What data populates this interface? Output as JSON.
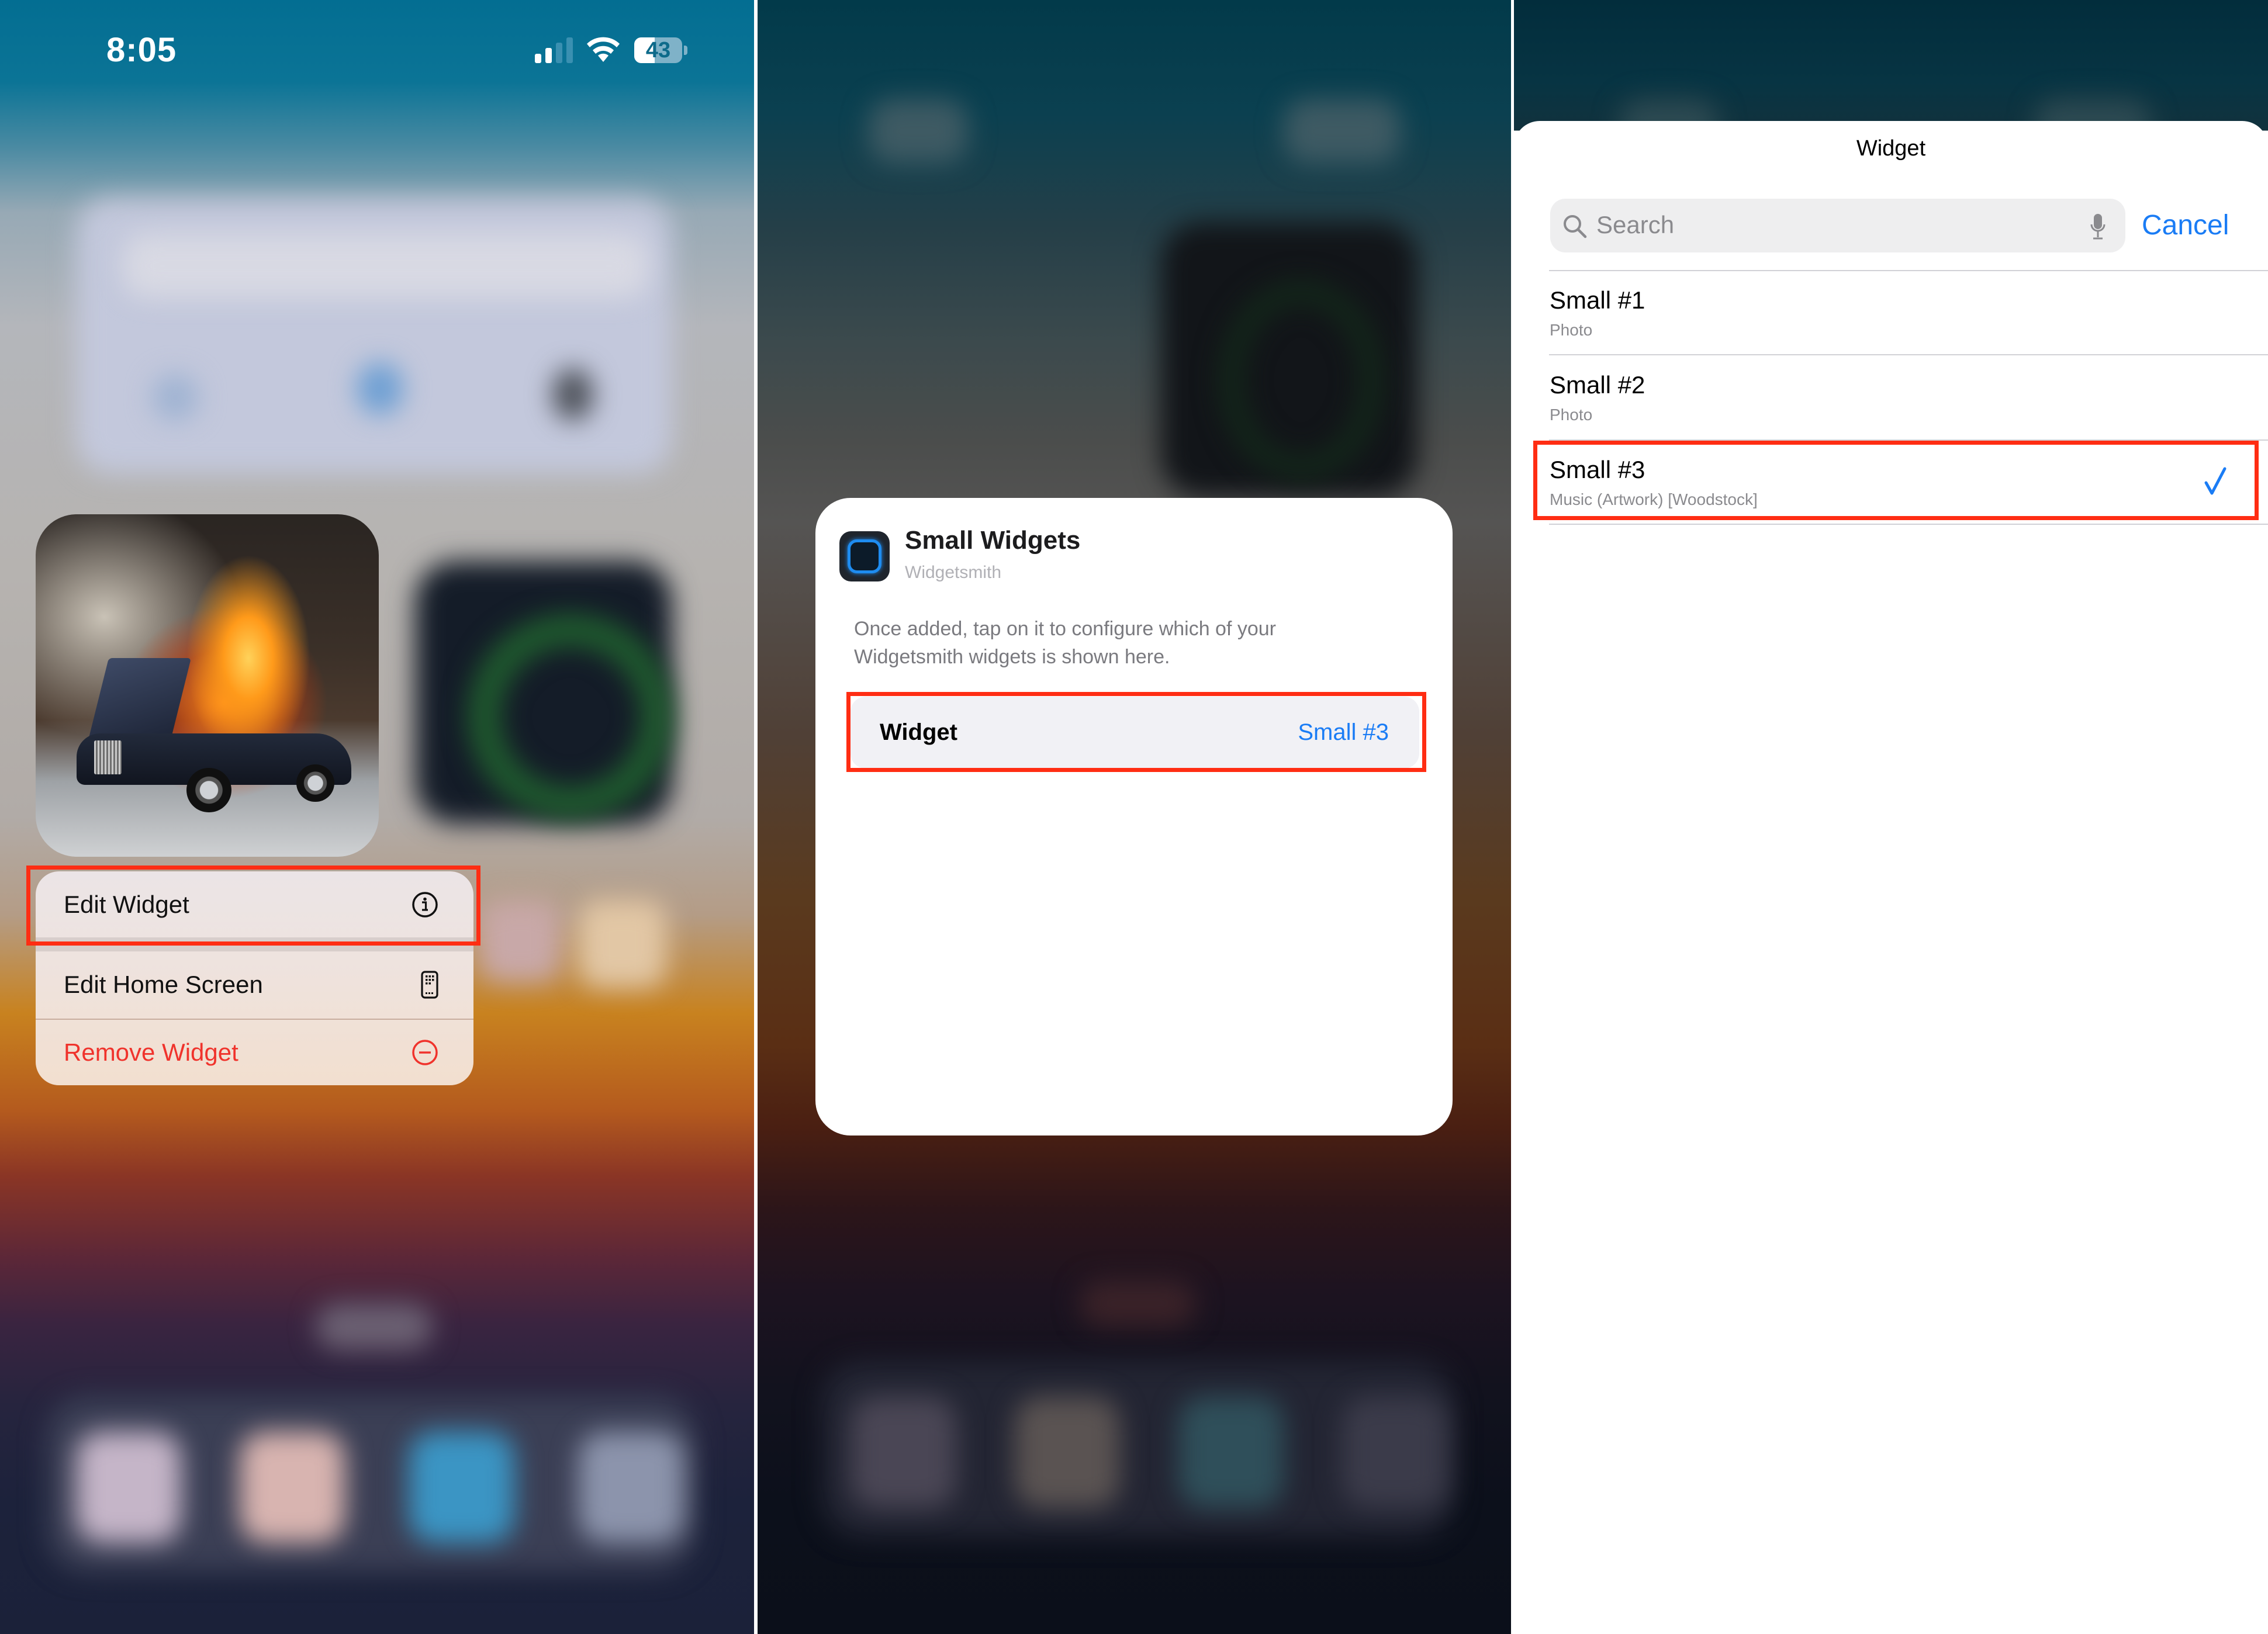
{
  "status_bar": {
    "time": "8:05",
    "signal_bars_total": 4,
    "signal_bars_active": 2,
    "battery_percent": 43,
    "battery_label": "43"
  },
  "colors": {
    "accent_blue": "#1a7cf5",
    "destructive_red": "#f0332c",
    "highlight_box": "#ff2d13",
    "secondary_text": "#8a8a8e"
  },
  "left_panel": {
    "widget_image": "burning-car-artwork",
    "context_menu": {
      "items": [
        {
          "label": "Edit Widget",
          "icon": "info-icon",
          "highlighted": true
        },
        {
          "label": "Edit Home Screen",
          "icon": "phone-apps-icon",
          "highlighted": false
        },
        {
          "label": "Remove Widget",
          "icon": "minus-circle-icon",
          "destructive": true
        }
      ]
    }
  },
  "middle_panel": {
    "dialog": {
      "app_name": "Small Widgets",
      "app_developer": "Widgetsmith",
      "description": "Once added, tap on it to configure which of your Widgetsmith widgets is shown here.",
      "setting": {
        "label": "Widget",
        "value": "Small #3",
        "highlighted": true
      }
    }
  },
  "right_panel": {
    "sheet_title": "Widget",
    "search": {
      "placeholder": "Search",
      "value": ""
    },
    "cancel_label": "Cancel",
    "options": [
      {
        "title": "Small #1",
        "subtitle": "Photo",
        "selected": false
      },
      {
        "title": "Small #2",
        "subtitle": "Photo",
        "selected": false
      },
      {
        "title": "Small #3",
        "subtitle": "Music (Artwork) [Woodstock]",
        "selected": true
      }
    ]
  }
}
